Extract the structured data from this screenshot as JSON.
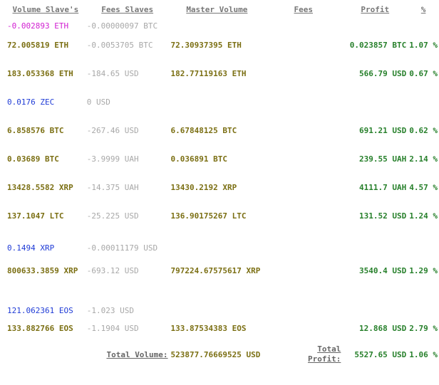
{
  "headers": {
    "volume_slaves": "Volume Slave's",
    "fees_slaves": "Fees Slaves",
    "master_volume": "Master Volume",
    "fees": "Fees",
    "profit": "Profit",
    "percent": "%"
  },
  "rows": [
    {
      "vol": "-0.002893 ETH",
      "fee": "-0.00000097 BTC"
    },
    {
      "vol": "72.005819 ETH",
      "fee": "-0.0053705 BTC",
      "master": "72.30937395 ETH",
      "profit": "0.023857 BTC",
      "pct": "1.07 %"
    },
    {
      "vol": "183.053368 ETH",
      "fee": "-184.65 USD",
      "master": "182.77119163 ETH",
      "profit": "566.79 USD",
      "pct": "0.67 %"
    },
    {
      "vol": "0.0176 ZEC",
      "fee": "0 USD"
    },
    {
      "vol": "6.858576 BTC",
      "fee": "-267.46 USD",
      "master": "6.67848125 BTC",
      "profit": "691.21 USD",
      "pct": "0.62 %"
    },
    {
      "vol": "0.03689 BTC",
      "fee": "-3.9999 UAH",
      "master": "0.036891 BTC",
      "profit": "239.55 UAH",
      "pct": "2.14 %"
    },
    {
      "vol": "13428.5582 XRP",
      "fee": "-14.375 UAH",
      "master": "13430.2192 XRP",
      "profit": "4111.7 UAH",
      "pct": "4.57 %"
    },
    {
      "vol": "137.1047 LTC",
      "fee": "-25.225 USD",
      "master": "136.90175267 LTC",
      "profit": "131.52 USD",
      "pct": "1.24 %"
    },
    {
      "vol": "0.1494 XRP",
      "fee": "-0.00011179 USD"
    },
    {
      "vol": "800633.3859 XRP",
      "fee": "-693.12 USD",
      "master": "797224.67575617 XRP",
      "profit": "3540.4 USD",
      "pct": "1.29 %"
    },
    {
      "vol": "121.062361 EOS",
      "fee": "-1.023 USD"
    },
    {
      "vol": "133.882766 EOS",
      "fee": "-1.1904 USD",
      "master": "133.87534383 EOS",
      "profit": "12.868 USD",
      "pct": "2.79 %"
    }
  ],
  "totals": {
    "total_volume_label": "Total Volume:",
    "total_volume_value": "523877.76669525 USD",
    "total_profit_label_1": "Total",
    "total_profit_label_2": "Profit:",
    "total_profit_value": "5527.65 USD",
    "total_profit_pct": "1.06 %"
  },
  "colors": {
    "olive": "#7b6f13",
    "gray": "#a8a8a8",
    "magenta": "#d11fd1",
    "blue": "#1f3bd6",
    "green": "#27802b"
  }
}
